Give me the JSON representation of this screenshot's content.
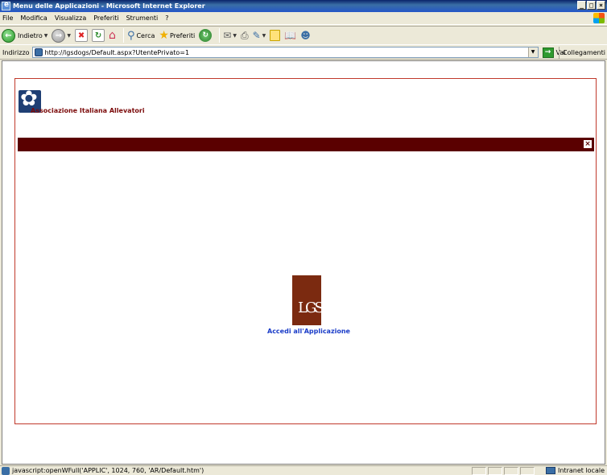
{
  "window": {
    "title": "Menu delle Applicazioni - Microsoft Internet Explorer",
    "minimize": "_",
    "restore": "□",
    "close": "×"
  },
  "menubar": {
    "items": [
      "File",
      "Modifica",
      "Visualizza",
      "Preferiti",
      "Strumenti",
      "?"
    ]
  },
  "toolbar": {
    "back": "Indietro",
    "search": "Cerca",
    "favorites": "Preferiti"
  },
  "address": {
    "label": "Indirizzo",
    "url": "http://lgsdogs/Default.aspx?UtentePrivato=1",
    "go": "Vai",
    "links": "Collegamenti"
  },
  "page": {
    "org_name": "Associazione Italiana Allevatori",
    "app_logo": "LGS",
    "app_link": "Accedi all'Applicazione",
    "banner_color": "#5a0000",
    "frame_color": "#c0392b"
  },
  "status": {
    "text": "javascript:openWFull('APPLIC', 1024, 760, 'AR/Default.htm')",
    "zone": "Intranet locale"
  }
}
